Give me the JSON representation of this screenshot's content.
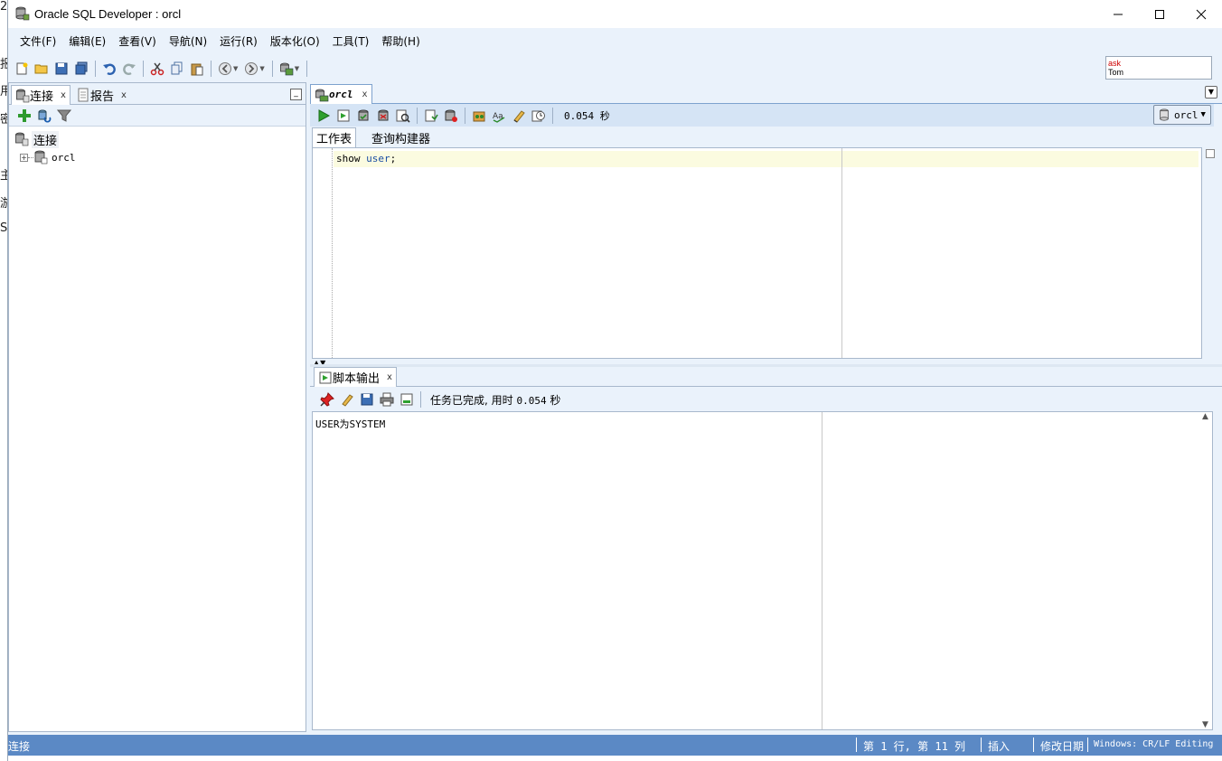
{
  "window": {
    "title": "Oracle SQL Developer : orcl"
  },
  "desktop_fragments": [
    "2",
    "报",
    "用",
    "密",
    "主",
    "游",
    "S"
  ],
  "menu": [
    "文件(F)",
    "编辑(E)",
    "查看(V)",
    "导航(N)",
    "运行(R)",
    "版本化(O)",
    "工具(T)",
    "帮助(H)"
  ],
  "asktom": {
    "line1": "ask",
    "line2": "Tom"
  },
  "left_panel": {
    "tabs": [
      {
        "label": "连接",
        "close": "x"
      },
      {
        "label": "报告",
        "close": "x"
      }
    ],
    "tree": {
      "root": "连接",
      "children": [
        "orcl"
      ]
    }
  },
  "editor": {
    "tab": {
      "label": "orcl",
      "close": "x"
    },
    "exec_time": "0.054 秒",
    "connection": "orcl",
    "sub_tabs": [
      "工作表",
      "查询构建器"
    ],
    "code": {
      "keyword": "show",
      "identifier": "user",
      "terminator": ";"
    }
  },
  "output": {
    "tab": {
      "label": "脚本输出",
      "close": "x"
    },
    "status_prefix": "任务已完成, 用时",
    "status_value": "0.054",
    "status_unit": "秒",
    "text": "USER为SYSTEM"
  },
  "statusbar": {
    "left": "连接",
    "position": "第 1 行, 第 11 列",
    "mode": "插入",
    "modified": "修改日期",
    "encoding": "Windows: CR/LF Editing"
  }
}
